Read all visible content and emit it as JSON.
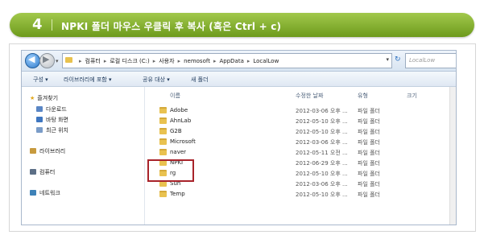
{
  "step": {
    "number": "4",
    "title": "NPKI 폴더 마우스 우클릭 후 복사 (혹은 Ctrl + c)"
  },
  "address_bar": {
    "crumbs": [
      "컴퓨터",
      "로컬 디스크 (C:)",
      "사용자",
      "nemosoft",
      "AppData",
      "LocalLow"
    ],
    "search_placeholder": "LocalLow"
  },
  "toolbar": {
    "items": [
      "구성 ▾",
      "라이브러리에 포함 ▾",
      "공유 대상 ▾",
      "새 폴더"
    ]
  },
  "nav_pane": {
    "favorites": "즐겨찾기",
    "favorites_items": [
      "다운로드",
      "바탕 화면",
      "최근 위치"
    ],
    "libraries": "라이브러리",
    "computer": "컴퓨터",
    "network": "네트워크"
  },
  "columns": {
    "name": "이름",
    "date": "수정한 날짜",
    "type": "유형",
    "size": "크기"
  },
  "files": [
    {
      "name": "Adobe",
      "date": "2012-03-06 오후 ...",
      "type": "파일 폴더"
    },
    {
      "name": "AhnLab",
      "date": "2012-05-10 오후 ...",
      "type": "파일 폴더"
    },
    {
      "name": "G2B",
      "date": "2012-05-10 오후 ...",
      "type": "파일 폴더"
    },
    {
      "name": "Microsoft",
      "date": "2012-03-06 오후 ...",
      "type": "파일 폴더"
    },
    {
      "name": "naver",
      "date": "2012-05-11 오전 ...",
      "type": "파일 폴더"
    },
    {
      "name": "NPKI",
      "date": "2012-06-29 오후 ...",
      "type": "파일 폴더"
    },
    {
      "name": "rg",
      "date": "2012-05-10 오후 ...",
      "type": "파일 폴더"
    },
    {
      "name": "Sun",
      "date": "2012-03-06 오후 ...",
      "type": "파일 폴더"
    },
    {
      "name": "Temp",
      "date": "2012-05-10 오후 ...",
      "type": "파일 폴더"
    }
  ],
  "colors": {
    "step_bar": "#7fae2a",
    "highlight_box": "#a8232a",
    "folder": "#e9c250"
  }
}
